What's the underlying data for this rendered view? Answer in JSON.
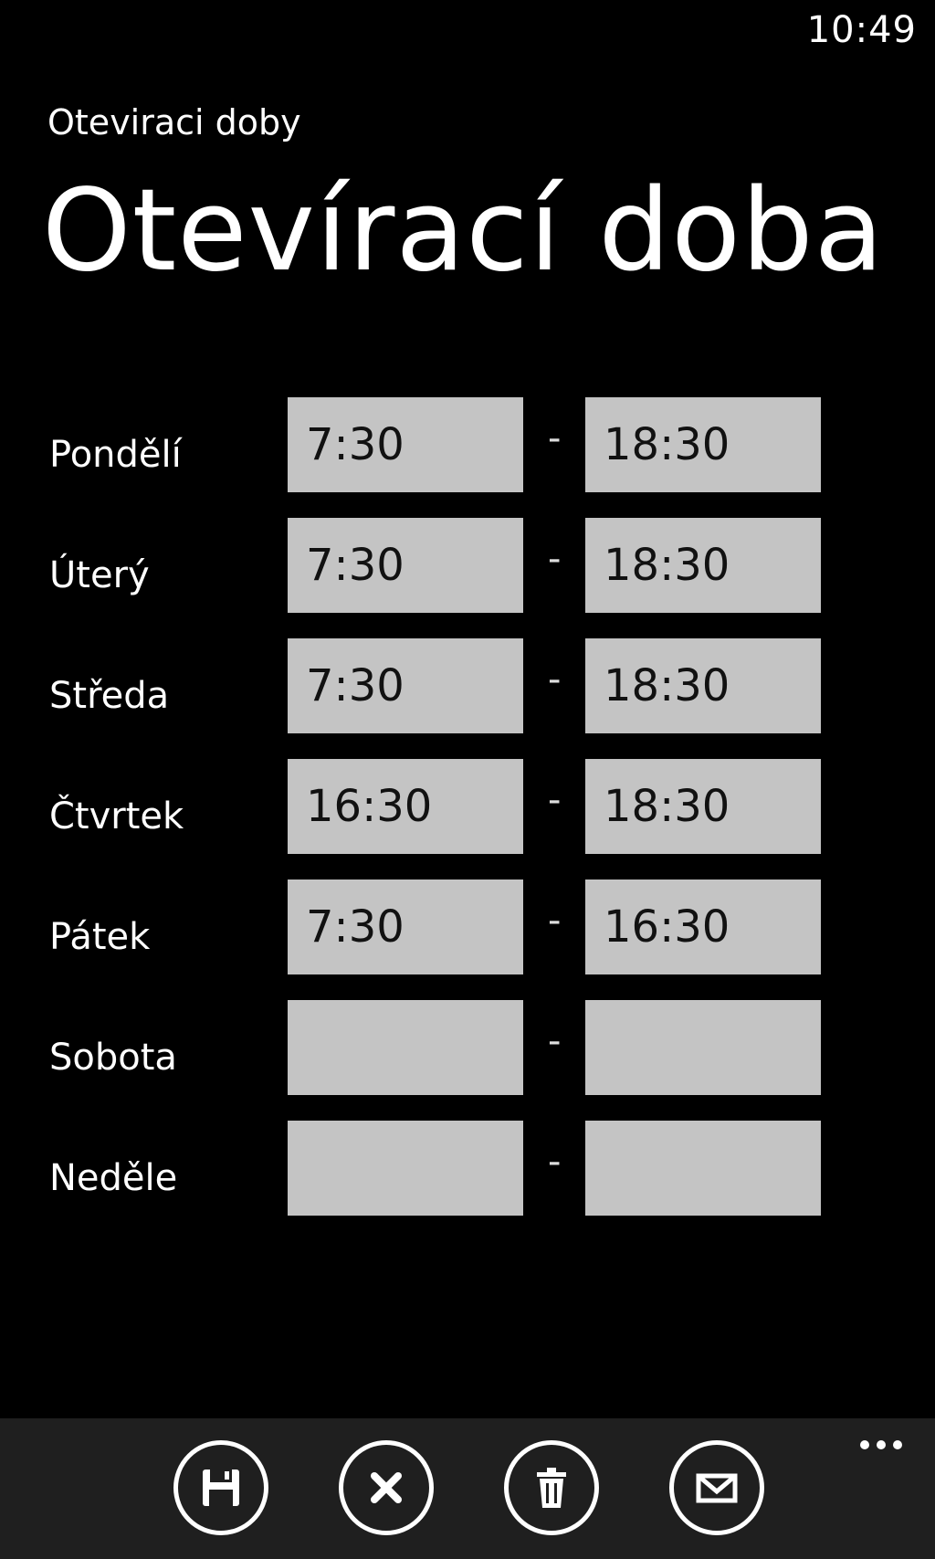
{
  "status": {
    "time": "10:49"
  },
  "app": {
    "subtitle": "Oteviraci doby",
    "title": "Otevírací doba"
  },
  "days": [
    {
      "label": "Pondělí",
      "open": "7:30",
      "close": "18:30"
    },
    {
      "label": "Úterý",
      "open": "7:30",
      "close": "18:30"
    },
    {
      "label": "Středa",
      "open": "7:30",
      "close": "18:30"
    },
    {
      "label": "Čtvrtek",
      "open": "16:30",
      "close": "18:30"
    },
    {
      "label": "Pátek",
      "open": "7:30",
      "close": "16:30"
    },
    {
      "label": "Sobota",
      "open": "",
      "close": ""
    },
    {
      "label": "Neděle",
      "open": "",
      "close": ""
    }
  ],
  "separator": "-",
  "app_bar": {
    "buttons": [
      "save-icon",
      "cancel-icon",
      "delete-icon",
      "email-icon"
    ],
    "more": "more-icon"
  }
}
